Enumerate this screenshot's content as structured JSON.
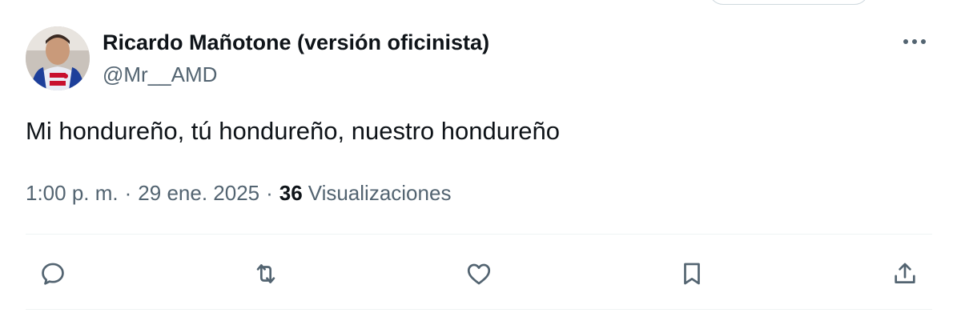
{
  "author": {
    "display_name": "Ricardo Mañotone (versión oficinista)",
    "handle": "@Mr__AMD"
  },
  "tweet": {
    "text": "Mi hondureño, tú hondureño, nuestro hondureño",
    "time": "1:00 p. m.",
    "separator": "·",
    "date": "29 ene. 2025",
    "views_count": "36",
    "views_label": "Visualizaciones"
  },
  "icons": {
    "more": "more-horizontal-icon",
    "reply": "reply-bubble-icon",
    "retweet": "retweet-icon",
    "like": "heart-icon",
    "bookmark": "bookmark-icon",
    "share": "share-upload-icon"
  },
  "colors": {
    "text_primary": "#0f1419",
    "text_secondary": "#536471",
    "divider": "#eff3f4"
  }
}
